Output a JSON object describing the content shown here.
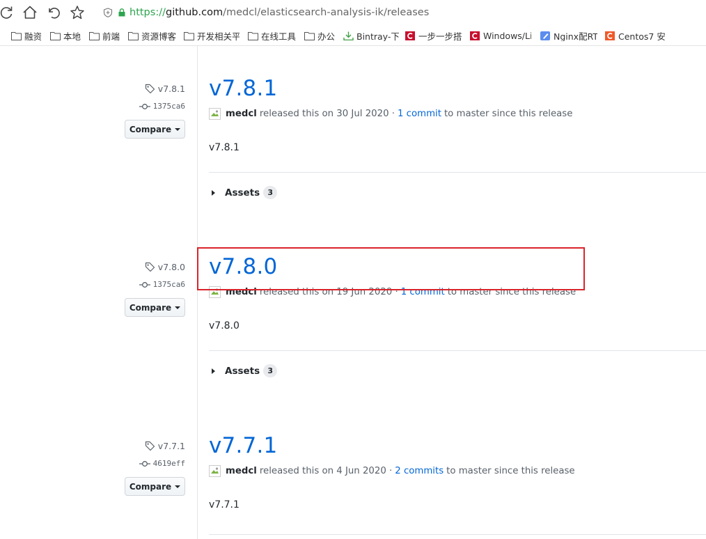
{
  "browser": {
    "url_scheme": "https://",
    "url_host": "github.com",
    "url_path": "/medcl/elasticsearch-analysis-ik/releases",
    "bookmarks": [
      {
        "label": "融资",
        "icon": "folder-icon"
      },
      {
        "label": "本地",
        "icon": "folder-icon"
      },
      {
        "label": "前端",
        "icon": "folder-icon"
      },
      {
        "label": "资源博客",
        "icon": "folder-icon"
      },
      {
        "label": "开发相关平",
        "icon": "folder-icon"
      },
      {
        "label": "在线工具",
        "icon": "folder-icon"
      },
      {
        "label": "办公",
        "icon": "folder-icon"
      },
      {
        "label": "Bintray-下",
        "icon": "download-icon"
      },
      {
        "label": "一步一步搭",
        "icon": "csdn-icon"
      },
      {
        "label": "Windows/Li",
        "icon": "csdn-icon"
      },
      {
        "label": "Nginx配RT",
        "icon": "pencil-icon"
      },
      {
        "label": "Centos7 安",
        "icon": "csdn-orange-icon"
      }
    ]
  },
  "releases": [
    {
      "tag": "v7.8.1",
      "commit": "1375ca6",
      "compare_label": "Compare",
      "title": "v7.8.1",
      "author": "medcl",
      "released_text": "released this on 30 Jul 2020 ·",
      "commits_link": "1 commit",
      "commits_suffix": "to master since this release",
      "body": "v7.8.1",
      "assets_label": "Assets",
      "assets_count": "3"
    },
    {
      "tag": "v7.8.0",
      "commit": "1375ca6",
      "compare_label": "Compare",
      "title": "v7.8.0",
      "author": "medcl",
      "released_text": "released this on 19 Jun 2020 ·",
      "commits_link": "1 commit",
      "commits_suffix": "to master since this release",
      "body": "v7.8.0",
      "assets_label": "Assets",
      "assets_count": "3"
    },
    {
      "tag": "v7.7.1",
      "commit": "4619eff",
      "compare_label": "Compare",
      "title": "v7.7.1",
      "author": "medcl",
      "released_text": "released this on 4 Jun 2020 ·",
      "commits_link": "2 commits",
      "commits_suffix": "to master since this release",
      "body": "v7.7.1"
    }
  ],
  "colors": {
    "link": "#0366d6",
    "highlight": "#d9242b",
    "secure": "#2da44e"
  }
}
